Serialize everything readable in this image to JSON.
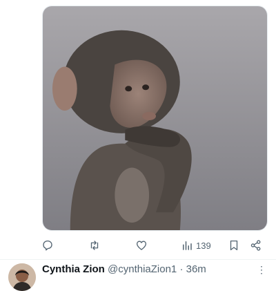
{
  "tweet": {
    "image_alt": "Baby monkey with hand on chin",
    "actions": {
      "reply": {
        "icon": "reply-icon"
      },
      "retweet": {
        "icon": "retweet-icon"
      },
      "like": {
        "icon": "heart-icon"
      },
      "views": {
        "icon": "views-icon",
        "count": "139"
      },
      "bookmark": {
        "icon": "bookmark-icon"
      },
      "share": {
        "icon": "share-icon"
      }
    }
  },
  "next_tweet": {
    "display_name": "Cynthia Zion",
    "handle": "@cynthiaZion1",
    "separator": "·",
    "time": "36m",
    "more": "⋮"
  },
  "colors": {
    "icon_gray": "#536471",
    "text_dark": "#0f1419",
    "divider": "#eff3f4"
  }
}
